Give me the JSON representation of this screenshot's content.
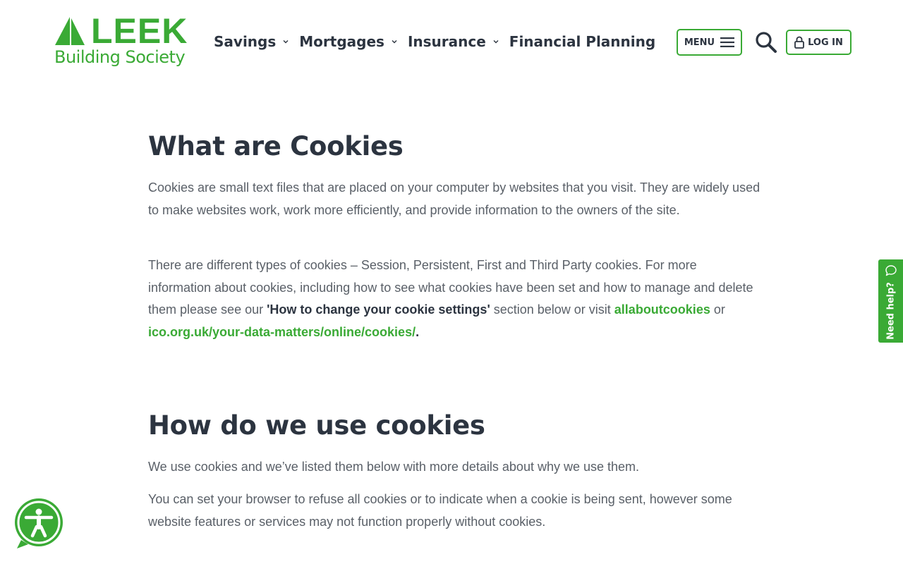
{
  "colors": {
    "brand_green": "#3aaa35",
    "heading_text": "#2c3440",
    "body_text": "#5a6068"
  },
  "header": {
    "logo": {
      "word": "LEEK",
      "sub": "Building Society"
    },
    "nav": [
      {
        "label": "Savings",
        "has_dropdown": true
      },
      {
        "label": "Mortgages",
        "has_dropdown": true
      },
      {
        "label": "Insurance",
        "has_dropdown": true
      },
      {
        "label": "Financial Planning",
        "has_dropdown": false
      }
    ],
    "menu_label": "MENU",
    "login_label": "LOG IN",
    "icons": {
      "menu": "hamburger-icon",
      "search": "search-icon",
      "login": "lock-icon"
    }
  },
  "sections": [
    {
      "title": "What are Cookies",
      "p1": "Cookies are small text files that are placed on your computer by websites that you visit. They are widely used to make websites work, work more efficiently, and provide information to the owners of the site.",
      "p2_start": "There are different types of cookies – Session, Persistent, First and Third Party cookies. For more information about cookies, including how to see what cookies have been set and how to manage and delete them please see our ",
      "p2_strong": "'How to change your cookie settings'",
      "p2_mid": " section below or visit ",
      "link1": "allaboutcookies",
      "p2_or": " or ",
      "link2": "ico.org.uk/your-data-matters/online/cookies/",
      "p2_end": "."
    },
    {
      "title": "How do we use cookies",
      "p1": "We use cookies and we’ve listed them below with more details about why we use them.",
      "p2": "You can set your browser to refuse all cookies or to indicate when a cookie is being sent, however some website features or services may not function properly without cookies."
    }
  ],
  "side_tab": {
    "label": "Need help?",
    "icon": "chat-bubble-icon"
  },
  "accessibility": {
    "icon": "accessibility-icon"
  }
}
